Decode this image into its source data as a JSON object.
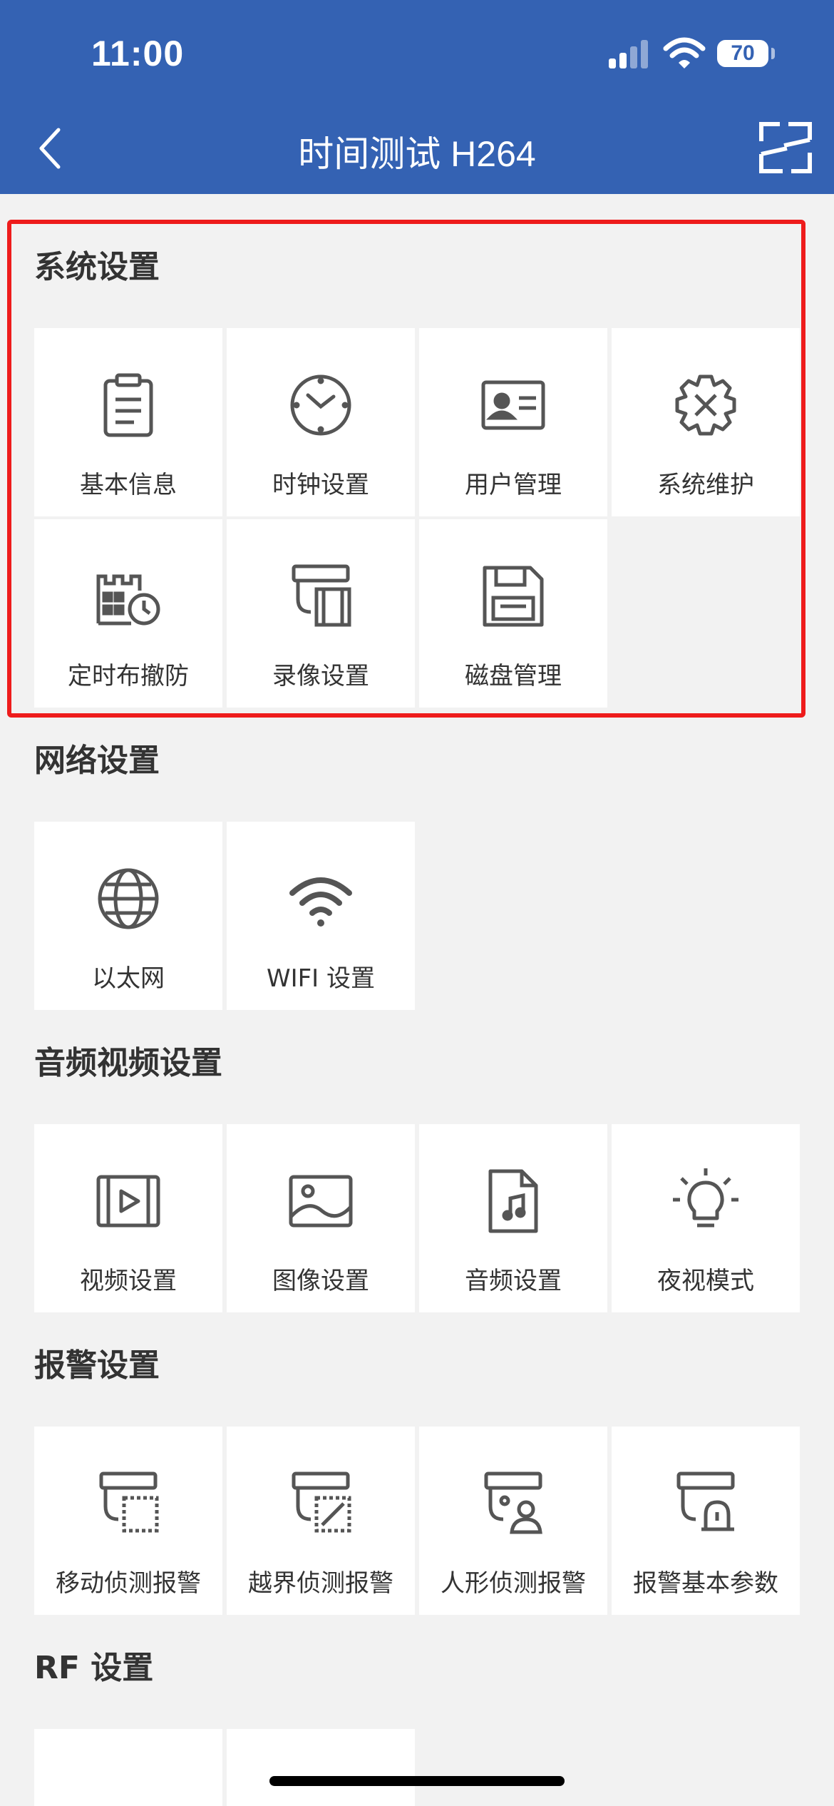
{
  "status_bar": {
    "time": "11:00",
    "battery": "70"
  },
  "header": {
    "title": "时间测试 H264"
  },
  "sections": {
    "system": {
      "title": "系统设置",
      "items": [
        {
          "label": "基本信息",
          "icon": "clipboard-icon"
        },
        {
          "label": "时钟设置",
          "icon": "clock-icon"
        },
        {
          "label": "用户管理",
          "icon": "id-card-icon"
        },
        {
          "label": "系统维护",
          "icon": "gear-tools-icon"
        },
        {
          "label": "定时布撤防",
          "icon": "castle-clock-icon"
        },
        {
          "label": "录像设置",
          "icon": "camera-film-icon"
        },
        {
          "label": "磁盘管理",
          "icon": "floppy-disk-icon"
        }
      ]
    },
    "network": {
      "title": "网络设置",
      "items": [
        {
          "label": "以太网",
          "icon": "globe-icon"
        },
        {
          "label": "WIFI 设置",
          "icon": "wifi-icon"
        }
      ]
    },
    "av": {
      "title": "音频视频设置",
      "items": [
        {
          "label": "视频设置",
          "icon": "film-play-icon"
        },
        {
          "label": "图像设置",
          "icon": "image-icon"
        },
        {
          "label": "音频设置",
          "icon": "music-file-icon"
        },
        {
          "label": "夜视模式",
          "icon": "lightbulb-icon"
        }
      ]
    },
    "alarm": {
      "title": "报警设置",
      "items": [
        {
          "label": "移动侦测报警",
          "icon": "motion-camera-icon"
        },
        {
          "label": "越界侦测报警",
          "icon": "line-cross-camera-icon"
        },
        {
          "label": "人形侦测报警",
          "icon": "human-camera-icon"
        },
        {
          "label": "报警基本参数",
          "icon": "alarm-camera-icon"
        }
      ]
    },
    "rf": {
      "title": "RF 设置"
    }
  },
  "colors": {
    "header_bg": "#3462b3",
    "highlight": "#ee1c1c",
    "icon": "#555555"
  }
}
